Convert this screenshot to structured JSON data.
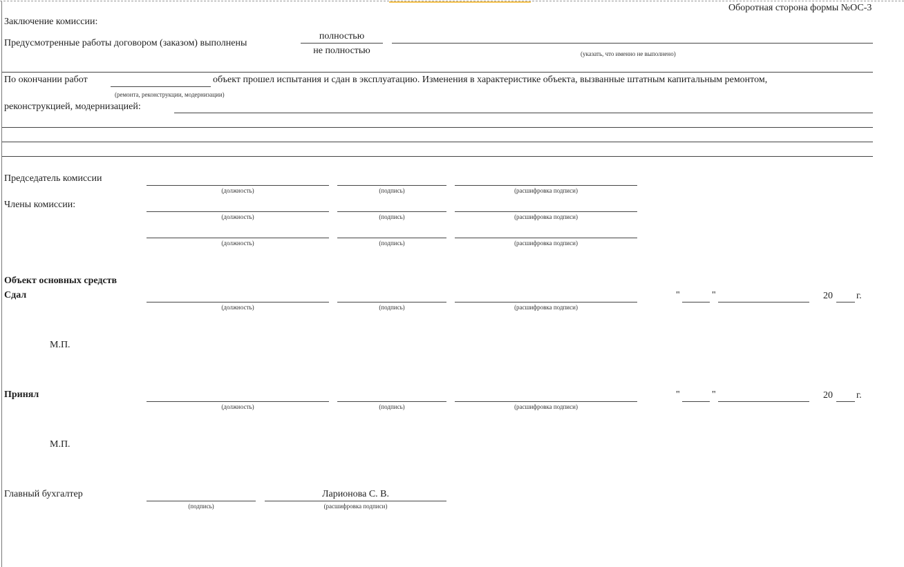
{
  "form_side_label": "Оборотная сторона формы №ОС-3",
  "conclusion": {
    "heading": "Заключение комиссии:",
    "works_text": "Предусмотренные работы договором (заказом) выполнены",
    "option_full": "полностью",
    "option_partial": "не полностью",
    "specify_hint": "(указать, что именно не выполнено)",
    "after_works_prefix": "По окончании работ",
    "after_works_text": "объект прошел испытания и сдан в эксплуатацию. Изменения в характеристике объекта, вызванные штатным капитальным ремонтом,",
    "repair_type_hint": "(ремонта, реконструкции, модернизации)",
    "modernization_text": "реконструкцией, модернизацией:"
  },
  "captions": {
    "position": "(должность)",
    "signature": "(подпись)",
    "signature_decoding": "(расшифровка подписи)"
  },
  "commission": {
    "chairman_label": "Председатель комиссии",
    "members_label": "Члены комиссии:"
  },
  "handover": {
    "object_title": "Объект основных средств",
    "handed_label": "Сдал",
    "received_label": "Принял",
    "stamp": "М.П.",
    "quote_open": "\"",
    "quote_close": "\"",
    "year_prefix": "20",
    "year_suffix": "г."
  },
  "chief_accountant": {
    "label": "Главный бухгалтер",
    "name": "Ларионова С. В."
  }
}
